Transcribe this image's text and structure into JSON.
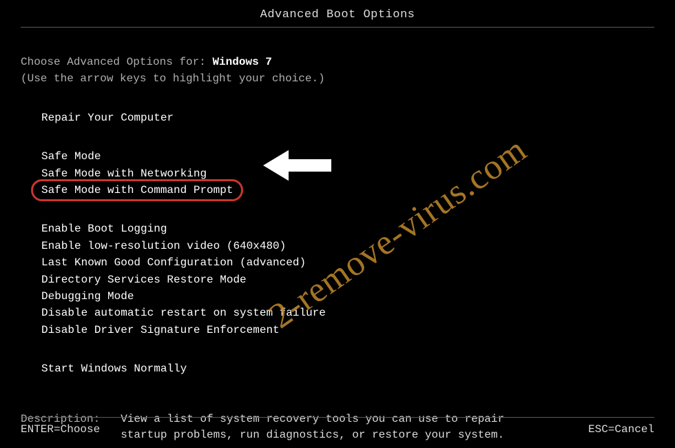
{
  "title": "Advanced Boot Options",
  "instruction_prefix": "Choose Advanced Options for: ",
  "os_name": "Windows 7",
  "hint": "(Use the arrow keys to highlight your choice.)",
  "group1": [
    "Repair Your Computer"
  ],
  "group2": [
    "Safe Mode",
    "Safe Mode with Networking",
    "Safe Mode with Command Prompt"
  ],
  "group3": [
    "Enable Boot Logging",
    "Enable low-resolution video (640x480)",
    "Last Known Good Configuration (advanced)",
    "Directory Services Restore Mode",
    "Debugging Mode",
    "Disable automatic restart on system failure",
    "Disable Driver Signature Enforcement"
  ],
  "group4": [
    "Start Windows Normally"
  ],
  "highlighted_index": 2,
  "description_label": "Description:",
  "description_text": "View a list of system recovery tools you can use to repair startup problems, run diagnostics, or restore your system.",
  "footer_left": "ENTER=Choose",
  "footer_right": "ESC=Cancel",
  "watermark": "2-remove-virus.com",
  "colors": {
    "highlight_border": "#c9362b",
    "watermark": "#c18a2c"
  }
}
